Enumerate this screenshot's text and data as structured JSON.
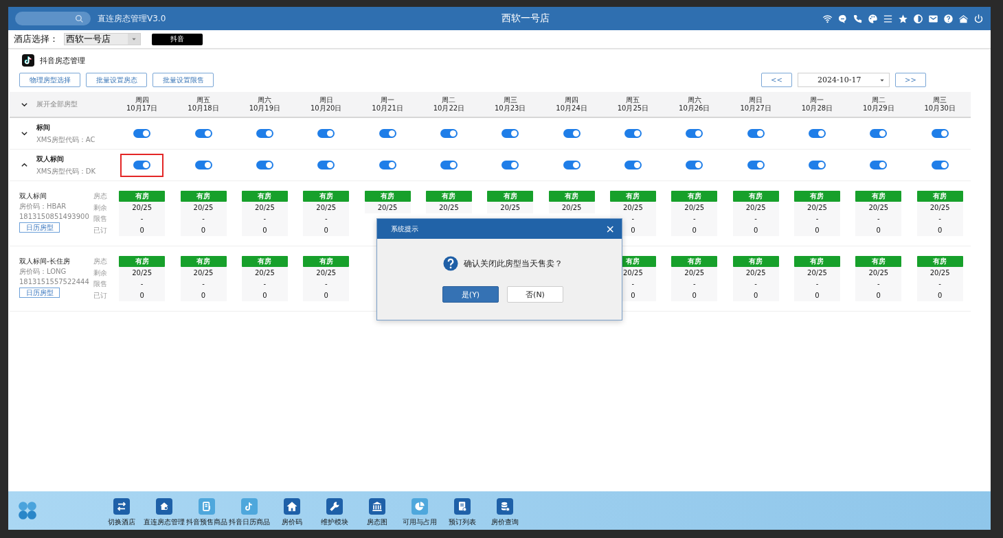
{
  "window": {
    "app_name": "直连房态管理V3.0",
    "title": "西软一号店"
  },
  "hotel_select": {
    "label": "酒店选择：",
    "value": "西软一号店"
  },
  "channel_button": "抖音",
  "section_title": "抖音房态管理",
  "action_buttons": [
    "物理房型选择",
    "批量设置房态",
    "批量设置限售"
  ],
  "date_nav": {
    "prev": "<<",
    "date": "2024-10-17",
    "next": ">>"
  },
  "expand_all": "展开全部房型",
  "days": [
    {
      "weekday": "周四",
      "date": "10月17日"
    },
    {
      "weekday": "周五",
      "date": "10月18日"
    },
    {
      "weekday": "周六",
      "date": "10月19日"
    },
    {
      "weekday": "周日",
      "date": "10月20日"
    },
    {
      "weekday": "周一",
      "date": "10月21日"
    },
    {
      "weekday": "周二",
      "date": "10月22日"
    },
    {
      "weekday": "周三",
      "date": "10月23日"
    },
    {
      "weekday": "周四",
      "date": "10月24日"
    },
    {
      "weekday": "周五",
      "date": "10月25日"
    },
    {
      "weekday": "周六",
      "date": "10月26日"
    },
    {
      "weekday": "周日",
      "date": "10月27日"
    },
    {
      "weekday": "周一",
      "date": "10月28日"
    },
    {
      "weekday": "周二",
      "date": "10月29日"
    },
    {
      "weekday": "周三",
      "date": "10月30日"
    }
  ],
  "room_types": [
    {
      "name": "标间",
      "code": "XMS房型代码：AC",
      "expanded": false,
      "toggles": [
        {
          "on": true,
          "highlighted": false
        },
        {
          "on": true,
          "highlighted": false
        },
        {
          "on": true,
          "highlighted": false
        },
        {
          "on": true,
          "highlighted": false
        },
        {
          "on": true,
          "highlighted": false
        },
        {
          "on": true,
          "highlighted": false
        },
        {
          "on": true,
          "highlighted": false
        },
        {
          "on": true,
          "highlighted": false
        },
        {
          "on": true,
          "highlighted": false
        },
        {
          "on": true,
          "highlighted": false
        },
        {
          "on": true,
          "highlighted": false
        },
        {
          "on": true,
          "highlighted": false
        },
        {
          "on": true,
          "highlighted": false
        },
        {
          "on": true,
          "highlighted": false
        }
      ]
    },
    {
      "name": "双人标间",
      "code": "XMS房型代码：DK",
      "expanded": true,
      "toggles": [
        {
          "on": true,
          "highlighted": true
        },
        {
          "on": true,
          "highlighted": false
        },
        {
          "on": true,
          "highlighted": false
        },
        {
          "on": true,
          "highlighted": false
        },
        {
          "on": true,
          "highlighted": false
        },
        {
          "on": true,
          "highlighted": false
        },
        {
          "on": true,
          "highlighted": false
        },
        {
          "on": true,
          "highlighted": false
        },
        {
          "on": true,
          "highlighted": false
        },
        {
          "on": true,
          "highlighted": false
        },
        {
          "on": true,
          "highlighted": false
        },
        {
          "on": true,
          "highlighted": false
        },
        {
          "on": true,
          "highlighted": false
        },
        {
          "on": true,
          "highlighted": false
        }
      ]
    }
  ],
  "rate_plans": [
    {
      "name": "双人标间",
      "rate_code": "房价码：HBAR",
      "id": "1813150851493900",
      "button": "日历房型",
      "row_labels": [
        "房态",
        "剩余",
        "限售",
        "已订"
      ],
      "cells": [
        {
          "status": "有房",
          "remaining": "20/25",
          "limit": "-",
          "booked": "0"
        },
        {
          "status": "有房",
          "remaining": "20/25",
          "limit": "-",
          "booked": "0"
        },
        {
          "status": "有房",
          "remaining": "20/25",
          "limit": "-",
          "booked": "0"
        },
        {
          "status": "有房",
          "remaining": "20/25",
          "limit": "-",
          "booked": "0"
        },
        {
          "status": "有房",
          "remaining": "20/25"
        },
        {
          "status": "有房",
          "remaining": "20/25"
        },
        {
          "status": "有房",
          "remaining": "20/25"
        },
        {
          "status": "有房",
          "remaining": "20/25"
        },
        {
          "status": "有房",
          "remaining": "20/25",
          "limit": "-",
          "booked": "0"
        },
        {
          "status": "有房",
          "remaining": "20/25",
          "limit": "-",
          "booked": "0"
        },
        {
          "status": "有房",
          "remaining": "20/25",
          "limit": "-",
          "booked": "0"
        },
        {
          "status": "有房",
          "remaining": "20/25",
          "limit": "-",
          "booked": "0"
        },
        {
          "status": "有房",
          "remaining": "20/25",
          "limit": "-",
          "booked": "0"
        },
        {
          "status": "有房",
          "remaining": "20/25",
          "limit": "-",
          "booked": "0"
        }
      ]
    },
    {
      "name": "双人标间-长住房",
      "rate_code": "房价码：LONG",
      "id": "1813151557522444",
      "button": "日历房型",
      "row_labels": [
        "房态",
        "剩余",
        "限售",
        "已订"
      ],
      "cells": [
        {
          "status": "有房",
          "remaining": "20/25",
          "limit": "-",
          "booked": "0"
        },
        {
          "status": "有房",
          "remaining": "20/25",
          "limit": "-",
          "booked": "0"
        },
        {
          "status": "有房",
          "remaining": "20/25",
          "limit": "-",
          "booked": "0"
        },
        {
          "status": "有房",
          "remaining": "20/25",
          "limit": "-",
          "booked": "0"
        },
        {},
        {},
        {},
        {},
        {
          "status": "有房",
          "remaining": "20/25",
          "limit": "-",
          "booked": "0"
        },
        {
          "status": "有房",
          "remaining": "20/25",
          "limit": "-",
          "booked": "0"
        },
        {
          "status": "有房",
          "remaining": "20/25",
          "limit": "-",
          "booked": "0"
        },
        {
          "status": "有房",
          "remaining": "20/25",
          "limit": "-",
          "booked": "0"
        },
        {
          "status": "有房",
          "remaining": "20/25",
          "limit": "-",
          "booked": "0"
        },
        {
          "status": "有房",
          "remaining": "20/25",
          "limit": "-",
          "booked": "0"
        }
      ]
    }
  ],
  "dialog": {
    "title": "系统提示",
    "close": "×",
    "message": "确认关闭此房型当天售卖？",
    "buttons": [
      {
        "label": "是(Y)",
        "selected": true
      },
      {
        "label": "否(N)",
        "selected": false
      }
    ]
  },
  "dock": [
    "切换酒店",
    "直连房态管理",
    "抖音预售商品",
    "抖音日历商品",
    "房价码",
    "维护模块",
    "房态图",
    "可用与占用",
    "预订列表",
    "房价查询"
  ]
}
